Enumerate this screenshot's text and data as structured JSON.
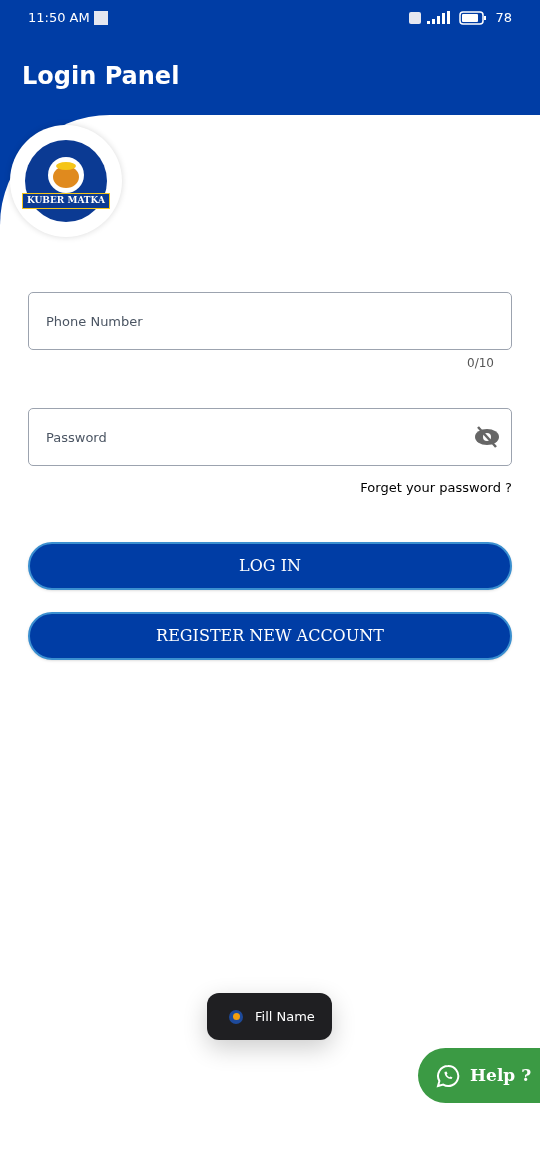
{
  "status_bar": {
    "time": "11:50 AM",
    "battery": "78"
  },
  "header": {
    "title": "Login Panel"
  },
  "logo": {
    "text": "KUBER MATKA"
  },
  "phone_field": {
    "placeholder": "Phone Number",
    "counter": "0/10"
  },
  "password_field": {
    "placeholder": "Password",
    "visible": false
  },
  "forgot_link": "Forget your password ?",
  "buttons": [
    {
      "label": "LOG IN"
    },
    {
      "label": "REGISTER NEW ACCOUNT"
    }
  ],
  "toast": {
    "text": "Fill Name"
  },
  "help_button": {
    "label": "Help ?"
  }
}
